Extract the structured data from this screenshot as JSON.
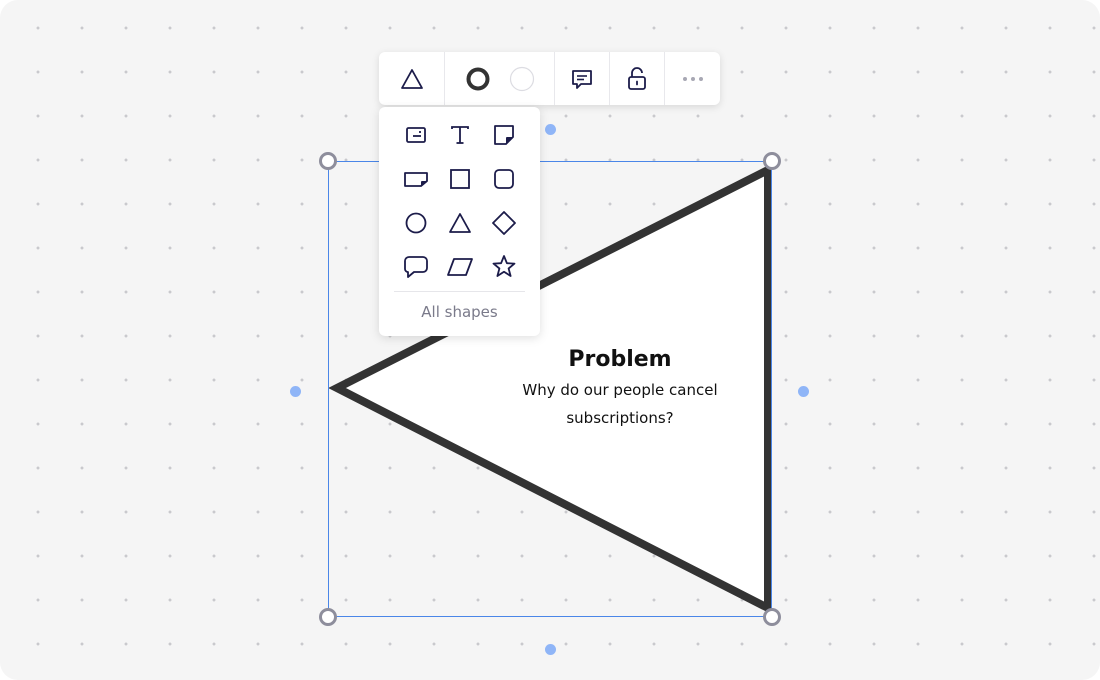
{
  "colors": {
    "canvas": "#f5f5f5",
    "selection": "#4a86e8",
    "shape_stroke": "#333333",
    "icon": "#1c1c4a"
  },
  "shape": {
    "type": "triangle",
    "title": "Problem",
    "body_line1": "Why do our people cancel",
    "body_line2": "subscriptions?"
  },
  "toolbar": {
    "items": [
      {
        "icon": "triangle-icon",
        "label": "Shape"
      },
      {
        "icon": "border-color-icon",
        "label": "Border color"
      },
      {
        "icon": "fill-color-icon",
        "label": "Fill color"
      },
      {
        "icon": "comment-icon",
        "label": "Comment"
      },
      {
        "icon": "unlock-icon",
        "label": "Lock"
      },
      {
        "icon": "more-icon",
        "label": "More"
      }
    ]
  },
  "shapes_menu": {
    "items": [
      "text-card-icon",
      "text-icon",
      "sticky-note-icon",
      "note-card-icon",
      "square-icon",
      "rounded-square-icon",
      "circle-icon",
      "triangle-icon",
      "diamond-icon",
      "speech-bubble-icon",
      "parallelogram-icon",
      "star-icon"
    ],
    "all_shapes_label": "All shapes"
  }
}
